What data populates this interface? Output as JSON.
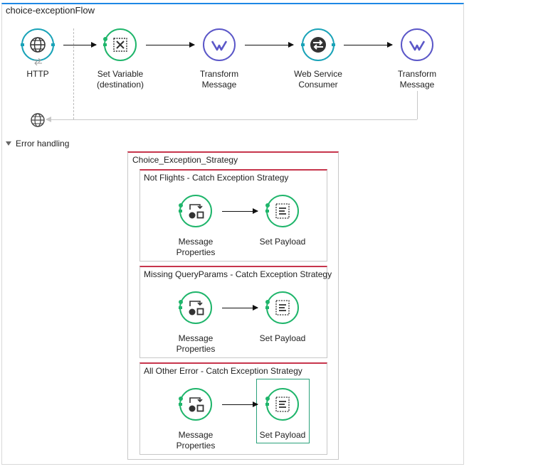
{
  "flow": {
    "title": "choice-exceptionFlow",
    "nodes": [
      {
        "label_lines": [
          "HTTP"
        ],
        "icon": "globe-icon",
        "kind": "endpoint"
      },
      {
        "label_lines": [
          "Set Variable",
          "(destination)"
        ],
        "icon": "variable-x-icon",
        "kind": "transformer"
      },
      {
        "label_lines": [
          "Transform",
          "Message"
        ],
        "icon": "dataweave-icon",
        "kind": "transformer"
      },
      {
        "label_lines": [
          "Web Service",
          "Consumer"
        ],
        "icon": "web-service-consumer-icon",
        "kind": "connector"
      },
      {
        "label_lines": [
          "Transform",
          "Message"
        ],
        "icon": "dataweave-icon",
        "kind": "transformer"
      }
    ],
    "response_icon": "globe-icon"
  },
  "error_handling": {
    "label": "Error handling",
    "choice_strategy": {
      "title": "Choice_Exception_Strategy",
      "catches": [
        {
          "title": "Not Flights - Catch Exception Strategy",
          "nodes": [
            {
              "label_lines": [
                "Message",
                "Properties"
              ],
              "icon": "message-properties-icon"
            },
            {
              "label_lines": [
                "Set Payload"
              ],
              "icon": "set-payload-icon"
            }
          ]
        },
        {
          "title": "Missing QueryParams - Catch Exception Strategy",
          "nodes": [
            {
              "label_lines": [
                "Message",
                "Properties"
              ],
              "icon": "message-properties-icon"
            },
            {
              "label_lines": [
                "Set Payload"
              ],
              "icon": "set-payload-icon"
            }
          ]
        },
        {
          "title": "All Other Error - Catch Exception Strategy",
          "nodes": [
            {
              "label_lines": [
                "Message",
                "Properties"
              ],
              "icon": "message-properties-icon"
            },
            {
              "label_lines": [
                "Set Payload"
              ],
              "icon": "set-payload-icon"
            }
          ]
        }
      ]
    }
  },
  "colors": {
    "flow_border": "#1e88e5",
    "endpoint": "#1aa3b8",
    "transformer": "#1fb56b",
    "dataweave": "#5b57c8",
    "connector": "#1aa3b8",
    "strategy_border": "#c7354c",
    "selection": "#2aa17a"
  }
}
